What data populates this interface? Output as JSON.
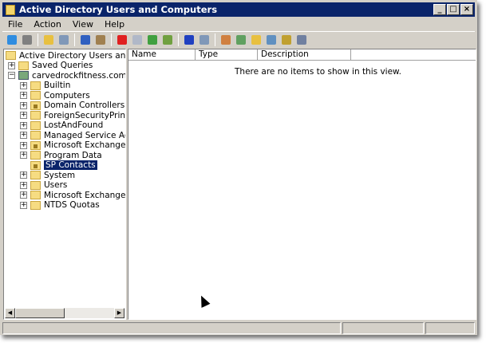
{
  "window": {
    "title": "Active Directory Users and Computers",
    "minimize": "_",
    "maximize": "□",
    "close": "×"
  },
  "menu": [
    "File",
    "Action",
    "View",
    "Help"
  ],
  "toolbar": [
    {
      "icon": "back-icon",
      "color": "#2f8de0"
    },
    {
      "icon": "forward-icon",
      "color": "#808080"
    },
    "sep",
    {
      "icon": "up-folder-icon",
      "color": "#e8c040"
    },
    {
      "icon": "show-console-tree-icon",
      "color": "#8098b8"
    },
    "sep",
    {
      "icon": "cut-icon",
      "color": "#3060c0"
    },
    {
      "icon": "paste-icon",
      "color": "#a08050"
    },
    "sep",
    {
      "icon": "delete-icon",
      "color": "#e02020"
    },
    {
      "icon": "properties-icon",
      "color": "#b0b8c8"
    },
    {
      "icon": "refresh-icon",
      "color": "#40a040"
    },
    {
      "icon": "export-list-icon",
      "color": "#70a040"
    },
    "sep",
    {
      "icon": "help-icon",
      "color": "#2040c0"
    },
    {
      "icon": "show-action-pane-icon",
      "color": "#8098b8"
    },
    "sep",
    {
      "icon": "new-user-icon",
      "color": "#d08040"
    },
    {
      "icon": "new-group-icon",
      "color": "#60a060"
    },
    {
      "icon": "new-ou-icon",
      "color": "#e8c040"
    },
    {
      "icon": "filter-icon",
      "color": "#6090c0"
    },
    {
      "icon": "find-icon",
      "color": "#c0a030"
    },
    {
      "icon": "add-to-group-icon",
      "color": "#7080a0"
    }
  ],
  "tree": [
    {
      "label": "Active Directory Users and Comput",
      "level": 0,
      "expander": "",
      "type": "root"
    },
    {
      "label": "Saved Queries",
      "level": 1,
      "expander": "+",
      "type": "folder"
    },
    {
      "label": "carvedrockfitness.com",
      "level": 1,
      "expander": "−",
      "type": "domain"
    },
    {
      "label": "Builtin",
      "level": 2,
      "expander": "+",
      "type": "folder"
    },
    {
      "label": "Computers",
      "level": 2,
      "expander": "+",
      "type": "folder"
    },
    {
      "label": "Domain Controllers",
      "level": 2,
      "expander": "+",
      "type": "ou"
    },
    {
      "label": "ForeignSecurityPrincipals",
      "level": 2,
      "expander": "+",
      "type": "folder"
    },
    {
      "label": "LostAndFound",
      "level": 2,
      "expander": "+",
      "type": "folder"
    },
    {
      "label": "Managed Service Accounts",
      "level": 2,
      "expander": "+",
      "type": "folder"
    },
    {
      "label": "Microsoft Exchange Securit",
      "level": 2,
      "expander": "+",
      "type": "ou"
    },
    {
      "label": "Program Data",
      "level": 2,
      "expander": "+",
      "type": "folder"
    },
    {
      "label": "SP Contacts",
      "level": 2,
      "expander": "",
      "type": "ou",
      "selected": true
    },
    {
      "label": "System",
      "level": 2,
      "expander": "+",
      "type": "folder"
    },
    {
      "label": "Users",
      "level": 2,
      "expander": "+",
      "type": "folder"
    },
    {
      "label": "Microsoft Exchange System",
      "level": 2,
      "expander": "+",
      "type": "folder"
    },
    {
      "label": "NTDS Quotas",
      "level": 2,
      "expander": "+",
      "type": "folder"
    }
  ],
  "list": {
    "columns": [
      "Name",
      "Type",
      "Description",
      ""
    ],
    "empty_message": "There are no items to show in this view."
  }
}
